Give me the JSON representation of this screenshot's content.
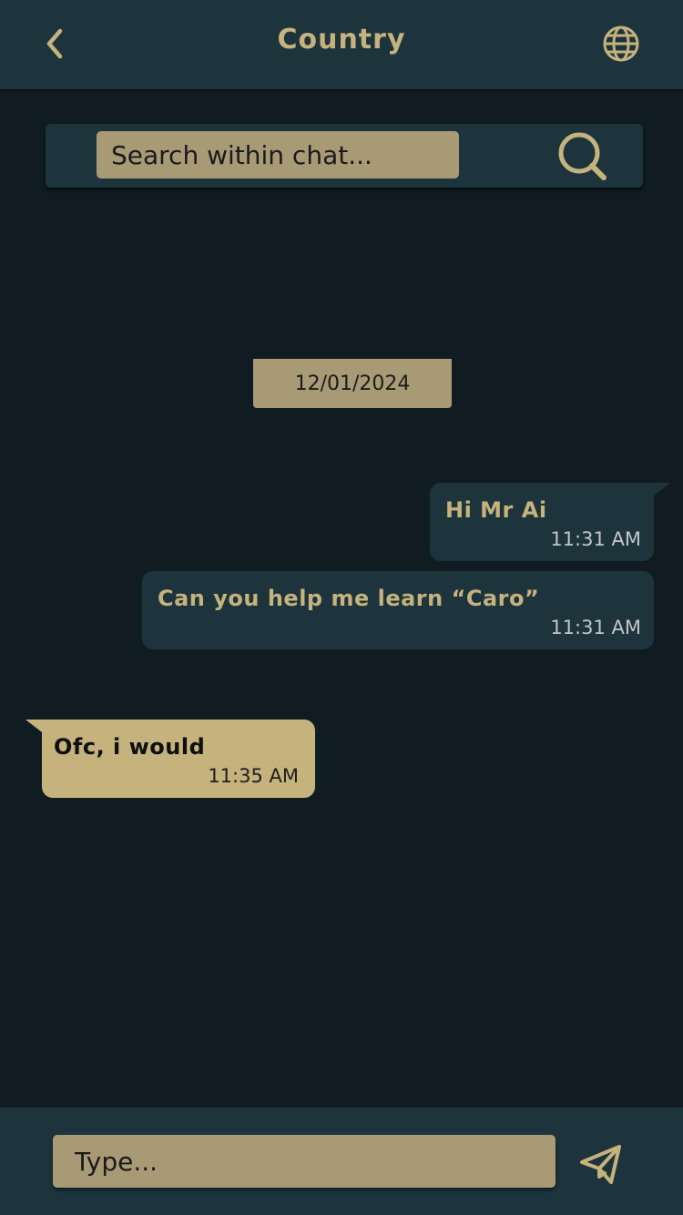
{
  "header": {
    "title": "Country",
    "back_icon": "chevron-left-icon",
    "globe_icon": "globe-icon"
  },
  "search": {
    "placeholder": "Search within chat...",
    "icon": "search-icon"
  },
  "date_separator": "12/01/2024",
  "messages": [
    {
      "direction": "sent",
      "text": "Hi Mr Ai",
      "time": "11:31 AM"
    },
    {
      "direction": "sent",
      "text": "Can you help me learn “Caro”",
      "time": "11:31 AM"
    },
    {
      "direction": "received",
      "text": "Ofc, i would",
      "time": "11:35 AM"
    }
  ],
  "composer": {
    "placeholder": "Type...",
    "send_icon": "send-icon"
  },
  "colors": {
    "background": "#101c22",
    "panel": "#1d343d",
    "accent_gold": "#c5b27c",
    "input_tan": "#a99a76"
  }
}
